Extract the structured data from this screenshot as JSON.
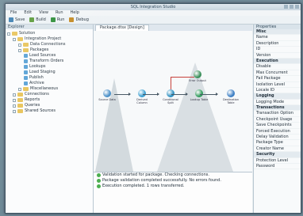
{
  "window": {
    "title": "SQL Integration Studio"
  },
  "menu": [
    "File",
    "Edit",
    "View",
    "Run",
    "Help"
  ],
  "toolbar": [
    {
      "label": "Save",
      "icon": "save-icon",
      "color": "#3c7fb1"
    },
    {
      "label": "Build",
      "icon": "build-icon",
      "color": "#5b9b3a"
    },
    {
      "label": "Run",
      "icon": "run-icon",
      "color": "#2f8f3a"
    },
    {
      "label": "Debug",
      "icon": "debug-icon",
      "color": "#c48a22"
    }
  ],
  "solution_panel": {
    "header": "Explorer",
    "items": [
      {
        "label": "Solution",
        "level": 0,
        "kind": "folder"
      },
      {
        "label": "Integration Project",
        "level": 1,
        "kind": "folder"
      },
      {
        "label": "Data Connections",
        "level": 2,
        "kind": "folder"
      },
      {
        "label": "Packages",
        "level": 2,
        "kind": "folder"
      },
      {
        "label": "Load Sources",
        "level": 3,
        "kind": "leaf"
      },
      {
        "label": "Transform Orders",
        "level": 3,
        "kind": "leaf"
      },
      {
        "label": "Lookups",
        "level": 3,
        "kind": "leaf"
      },
      {
        "label": "Load Staging",
        "level": 3,
        "kind": "leaf"
      },
      {
        "label": "Publish",
        "level": 3,
        "kind": "leaf"
      },
      {
        "label": "Archive",
        "level": 3,
        "kind": "leaf"
      },
      {
        "label": "Miscellaneous",
        "level": 2,
        "kind": "folder"
      },
      {
        "label": "Connections",
        "level": 1,
        "kind": "folder"
      },
      {
        "label": "Reports",
        "level": 1,
        "kind": "folder"
      },
      {
        "label": "Queries",
        "level": 1,
        "kind": "folder"
      },
      {
        "label": "Shared Sources",
        "level": 1,
        "kind": "folder"
      }
    ]
  },
  "document": {
    "tab_label": "Package.dtsx [Design]"
  },
  "flow": {
    "nodes": [
      {
        "label": "Source Data",
        "color": "#4a90c8"
      },
      {
        "label": "Derived Column",
        "color": "#3a9ed0"
      },
      {
        "label": "Conditional Split",
        "color": "#2c8fc0"
      },
      {
        "label": "Error Output",
        "color": "#3a8f5a"
      },
      {
        "label": "Lookup Table",
        "color": "#2f9a5a"
      },
      {
        "label": "Destination Table",
        "color": "#3d7fc4"
      }
    ]
  },
  "output": {
    "lines": [
      "Validation started for package. Checking connections.",
      "Package validation completed successfully. No errors found.",
      "Execution completed. 1 rows transferred."
    ]
  },
  "properties": {
    "header": "Properties",
    "rows": [
      {
        "label": "Misc",
        "category": true
      },
      {
        "label": "Name",
        "category": false
      },
      {
        "label": "Description",
        "category": false
      },
      {
        "label": "ID",
        "category": false
      },
      {
        "label": "Version",
        "category": false
      },
      {
        "label": "Execution",
        "category": true
      },
      {
        "label": "Disable",
        "category": false
      },
      {
        "label": "Max Concurrent",
        "category": false
      },
      {
        "label": "Fail Package",
        "category": false
      },
      {
        "label": "Isolation Level",
        "category": false
      },
      {
        "label": "Locale ID",
        "category": false
      },
      {
        "label": "Logging",
        "category": true
      },
      {
        "label": "Logging Mode",
        "category": false
      },
      {
        "label": "Transactions",
        "category": true
      },
      {
        "label": "Transaction Option",
        "category": false
      },
      {
        "label": "Checkpoint Usage",
        "category": false
      },
      {
        "label": "Save Checkpoints",
        "category": false
      },
      {
        "label": "Forced Execution",
        "category": false
      },
      {
        "label": "Delay Validation",
        "category": false
      },
      {
        "label": "Package Type",
        "category": false
      },
      {
        "label": "Creator Name",
        "category": false
      },
      {
        "label": "Security",
        "category": true
      },
      {
        "label": "Protection Level",
        "category": false
      },
      {
        "label": "Password",
        "category": false
      }
    ]
  }
}
